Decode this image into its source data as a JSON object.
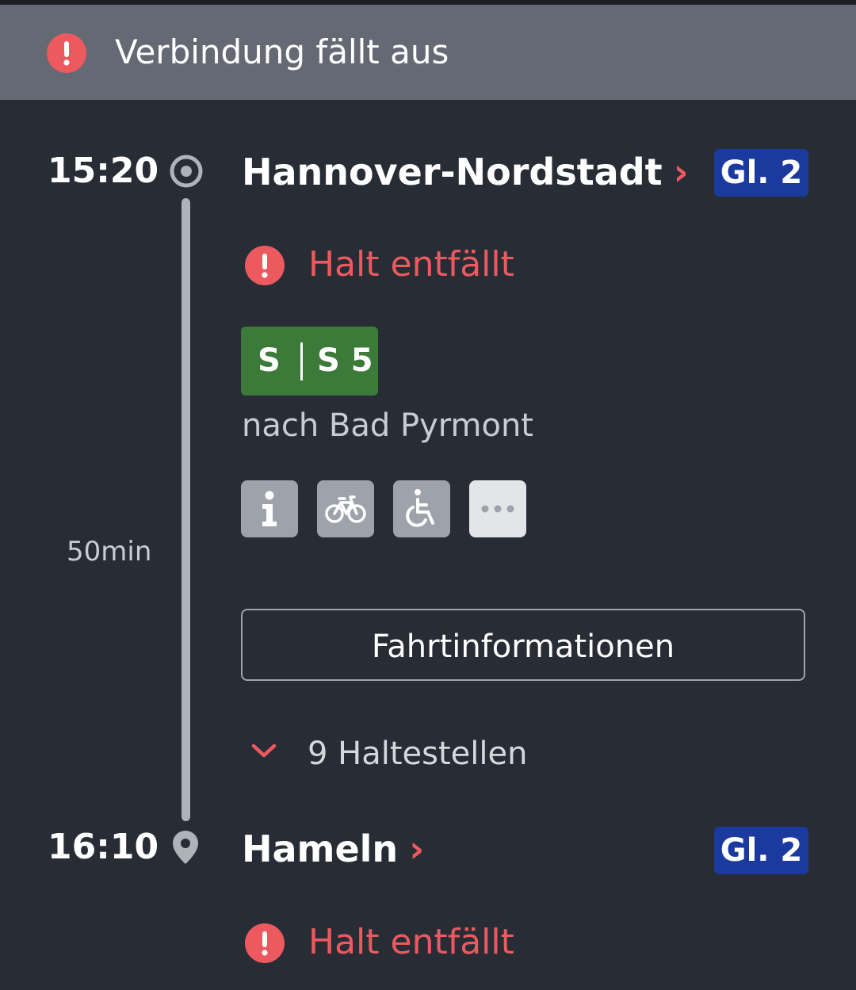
{
  "banner": {
    "text": "Verbindung fällt aus",
    "icon": "alert-icon"
  },
  "journey": {
    "departure": {
      "time": "15:20",
      "station": "Hannover-Nordstadt",
      "platform": "Gl. 2",
      "notice": "Halt entfällt"
    },
    "duration": "50min",
    "line": {
      "product": "S",
      "number": "S 5",
      "direction": "nach Bad Pyrmont",
      "color": "#3c7a3a"
    },
    "attributes": [
      "info-icon",
      "bicycle-icon",
      "wheelchair-icon",
      "more-icon"
    ],
    "details_button": "Fahrtinformationen",
    "stops_toggle": "9 Haltestellen",
    "arrival": {
      "time": "16:10",
      "station": "Hameln",
      "platform": "Gl. 2",
      "notice": "Halt entfällt"
    }
  },
  "colors": {
    "background": "#282c35",
    "banner": "#646973",
    "alert": "#ec5a5f",
    "platform": "#1a3aa0"
  }
}
